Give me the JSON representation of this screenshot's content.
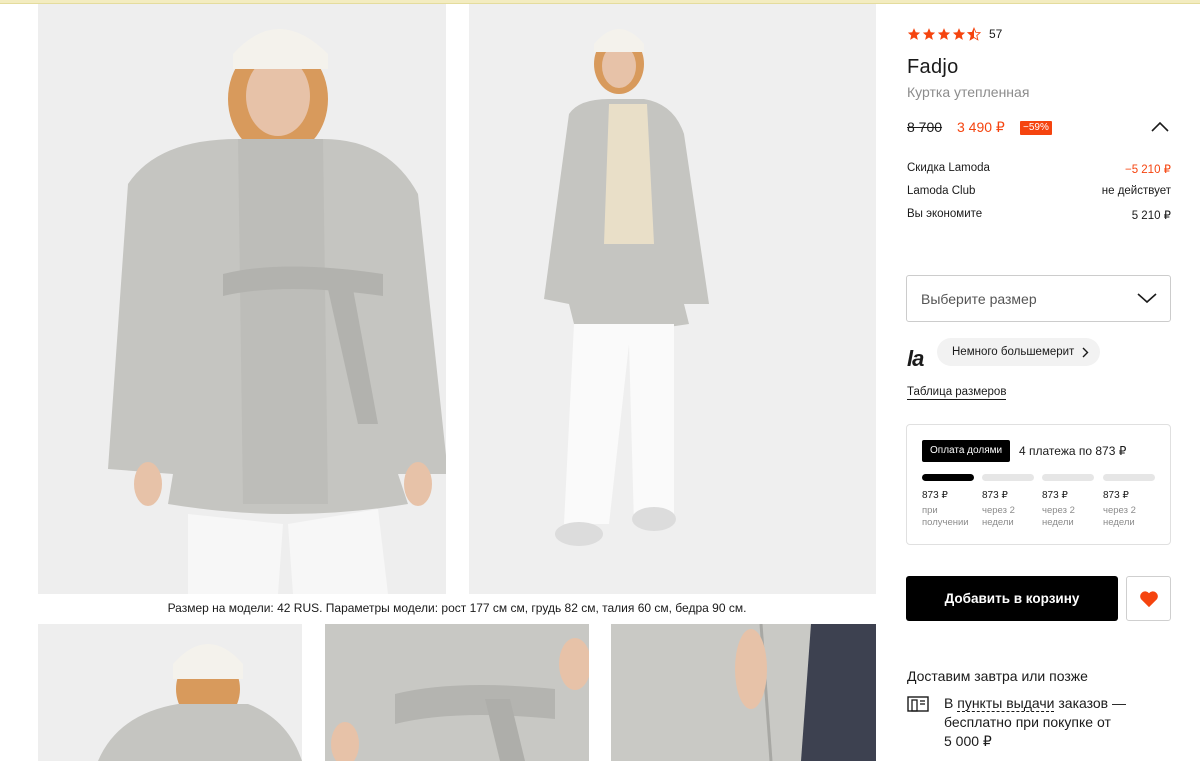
{
  "product": {
    "rating": 4.5,
    "reviews_count": "57",
    "brand": "Fadjo",
    "name": "Куртка утепленная",
    "old_price": "8 700",
    "new_price": "3 490 ₽",
    "discount_badge": "−59%",
    "model_caption": "Размер на модели: 42 RUS. Параметры модели: рост 177 см см, грудь 82 см, талия 60 см, бедра 90 см."
  },
  "price_breakdown": {
    "rows": [
      {
        "label": "Скидка Lamoda",
        "value": "−5 210 ₽"
      },
      {
        "label": "Lamoda Club",
        "value": "не действует"
      },
      {
        "label": "Вы экономите",
        "value": "5 210 ₽"
      }
    ]
  },
  "size": {
    "placeholder": "Выберите размер",
    "fit_hint": "Немного большемерит",
    "size_table_link": "Таблица размеров",
    "logo_text": "la"
  },
  "installments": {
    "badge": "Оплата долями",
    "summary": "4 платежа по 873 ₽",
    "payments": [
      {
        "amount": "873 ₽",
        "when": "при получении"
      },
      {
        "amount": "873 ₽",
        "when": "через 2 недели"
      },
      {
        "amount": "873 ₽",
        "when": "через 2 недели"
      },
      {
        "amount": "873 ₽",
        "when": "через 2 недели"
      }
    ]
  },
  "actions": {
    "add_to_cart": "Добавить в корзину"
  },
  "delivery": {
    "title": "Доставим завтра или позже",
    "line1_prefix": "В ",
    "line1_link": "пункты выдачи",
    "line1_suffix": " заказов —",
    "line2": "бесплатно при покупке от",
    "line3": "5 000 ₽"
  },
  "colors": {
    "accent": "#f5440f",
    "primary": "#000000",
    "favorite": "#f5440f",
    "muted": "#8c8c8c",
    "star": "#f5440f"
  },
  "icons": {
    "rating": "star-icon",
    "collapse": "chevron-up-icon",
    "select": "chevron-down-icon",
    "fit": "chevron-right-icon",
    "favorite": "heart-icon",
    "pickup": "pickup-point-icon"
  }
}
